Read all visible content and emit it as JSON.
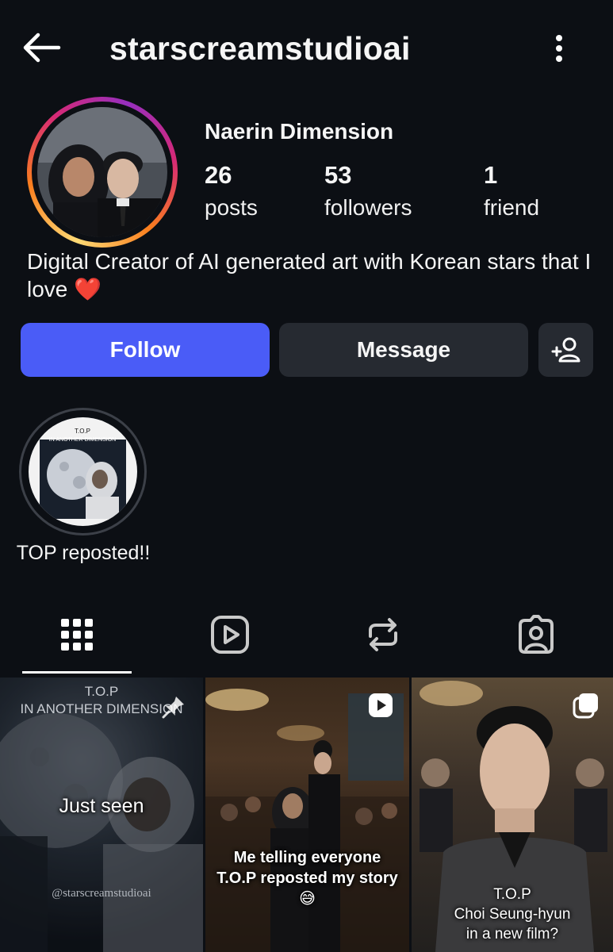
{
  "header": {
    "username": "starscreamstudioai"
  },
  "profile": {
    "display_name": "Naerin Dimension",
    "stats": [
      {
        "num": "26",
        "label": "posts"
      },
      {
        "num": "53",
        "label": "followers"
      },
      {
        "num": "1",
        "label": "friend"
      }
    ],
    "bio": "Digital Creator of AI generated art with Korean stars that I love",
    "bio_emoji": "❤️"
  },
  "buttons": {
    "follow": "Follow",
    "message": "Message"
  },
  "highlight": {
    "label": "TOP reposted!!",
    "cover_text_1": "T.O.P",
    "cover_text_2": "IN ANOTHER DIMENSION"
  },
  "tabs": [
    "grid-icon",
    "reels-icon",
    "reposts-icon",
    "tagged-icon"
  ],
  "posts": [
    {
      "title_1": "T.O.P",
      "title_2": "IN ANOTHER DIMENSION",
      "overlay": "Just seen",
      "watermark": "@starscreamstudioai",
      "icon": "pin-icon"
    },
    {
      "caption": "Me telling everyone T.O.P reposted my story 😅",
      "icon": "reel-icon"
    },
    {
      "caption_1": "T.O.P",
      "caption_2": "Choi Seung-hyun",
      "caption_3": "in a new film?",
      "icon": "carousel-icon"
    }
  ],
  "colors": {
    "background": "#0c0f14",
    "follow_button": "#4a5cf7",
    "secondary_button": "#262a31"
  }
}
